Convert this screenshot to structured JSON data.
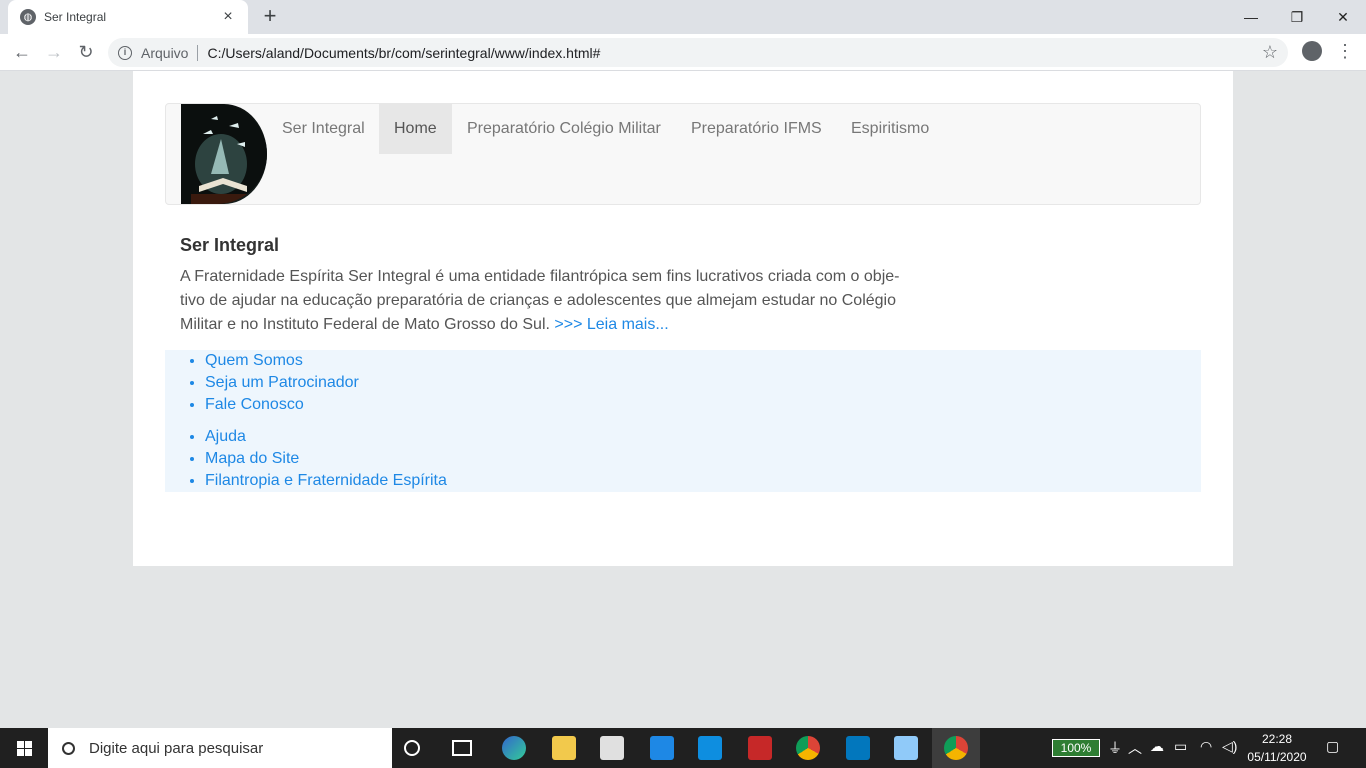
{
  "browser": {
    "tab_title": "Ser Integral",
    "tab_close": "×",
    "new_tab": "+",
    "minimize": "—",
    "restore": "❐",
    "close": "✕",
    "back": "←",
    "forward": "→",
    "reload": "↻",
    "info": "i",
    "scheme_label": "Arquivo",
    "url": "C:/Users/aland/Documents/br/com/serintegral/www/index.html#",
    "star": "☆",
    "menu": "⋮"
  },
  "navbar": {
    "items": [
      {
        "label": "Ser Integral",
        "active": false
      },
      {
        "label": "Home",
        "active": true
      },
      {
        "label": "Preparatório Colégio Militar",
        "active": false
      },
      {
        "label": "Preparatório IFMS",
        "active": false
      },
      {
        "label": "Espiritismo",
        "active": false
      }
    ]
  },
  "content": {
    "heading": "Ser Integral",
    "paragraph_line1": "A Fraternidade Espírita Ser Integral é uma entidade filantrópica sem fins lucrativos criada com o obje-",
    "paragraph_line2": "tivo de ajudar na educação preparatória de crianças e adolescentes que almejam estudar no Colégio",
    "paragraph_line3": "Militar e no Instituto Federal de Mato Grosso do Sul.",
    "read_more": ">>> Leia mais..."
  },
  "footer_links": {
    "group1": [
      "Quem Somos",
      "Seja um Patrocinador",
      "Fale Conosco"
    ],
    "group2": [
      "Ajuda",
      "Mapa do Site",
      "Filantropia e Fraternidade Espírita"
    ]
  },
  "taskbar": {
    "search_placeholder": "Digite aqui para pesquisar",
    "battery": "100%",
    "time": "22:28",
    "date": "05/11/2020"
  },
  "colors": {
    "link": "#1e88e5",
    "navbar_bg": "#f8f8f8",
    "links_box_bg": "#eef6fd"
  }
}
